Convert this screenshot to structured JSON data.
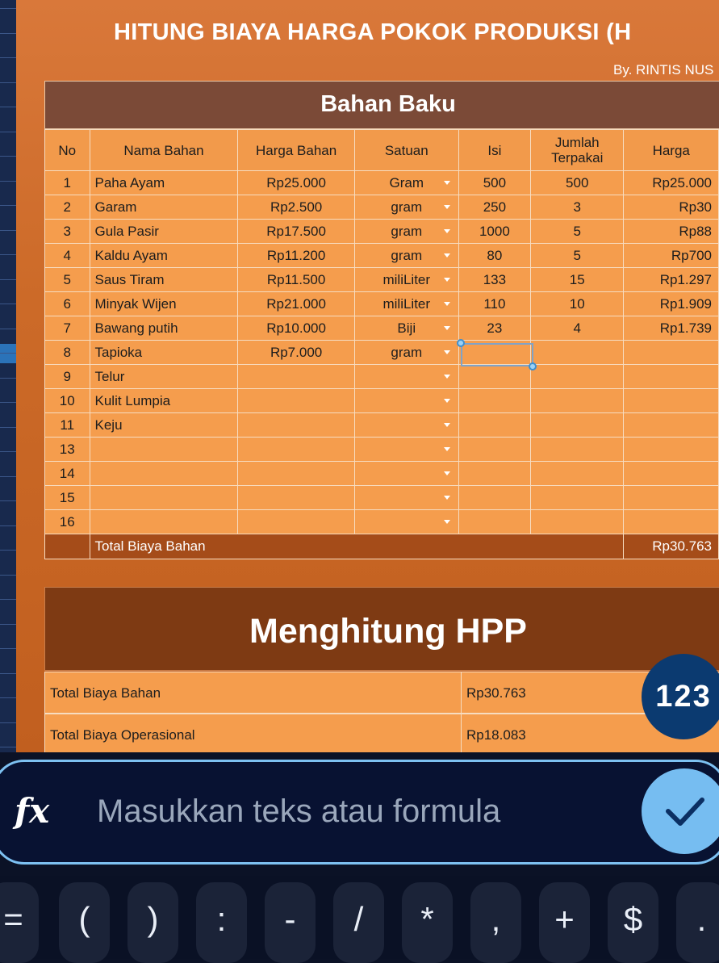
{
  "sheet": {
    "title": "HITUNG BIAYA HARGA POKOK PRODUKSI (H",
    "byline": "By. RINTIS NUS"
  },
  "bahan_baku": {
    "title": "Bahan Baku",
    "headers": [
      "No",
      "Nama Bahan",
      "Harga Bahan",
      "Satuan",
      "Isi",
      "Jumlah Terpakai",
      "Harga"
    ],
    "rows": [
      {
        "no": "1",
        "nama": "Paha Ayam",
        "harga_bahan": "Rp25.000",
        "satuan": "Gram",
        "isi": "500",
        "terpakai": "500",
        "harga": "Rp25.000"
      },
      {
        "no": "2",
        "nama": "Garam",
        "harga_bahan": "Rp2.500",
        "satuan": "gram",
        "isi": "250",
        "terpakai": "3",
        "harga": "Rp30"
      },
      {
        "no": "3",
        "nama": "Gula Pasir",
        "harga_bahan": "Rp17.500",
        "satuan": "gram",
        "isi": "1000",
        "terpakai": "5",
        "harga": "Rp88"
      },
      {
        "no": "4",
        "nama": "Kaldu Ayam",
        "harga_bahan": "Rp11.200",
        "satuan": "gram",
        "isi": "80",
        "terpakai": "5",
        "harga": "Rp700"
      },
      {
        "no": "5",
        "nama": "Saus Tiram",
        "harga_bahan": "Rp11.500",
        "satuan": "miliLiter",
        "isi": "133",
        "terpakai": "15",
        "harga": "Rp1.297"
      },
      {
        "no": "6",
        "nama": "Minyak Wijen",
        "harga_bahan": "Rp21.000",
        "satuan": "miliLiter",
        "isi": "110",
        "terpakai": "10",
        "harga": "Rp1.909"
      },
      {
        "no": "7",
        "nama": "Bawang putih",
        "harga_bahan": "Rp10.000",
        "satuan": "Biji",
        "isi": "23",
        "terpakai": "4",
        "harga": "Rp1.739"
      },
      {
        "no": "8",
        "nama": "Tapioka",
        "harga_bahan": "Rp7.000",
        "satuan": "gram",
        "isi": "",
        "terpakai": "",
        "harga": ""
      },
      {
        "no": "9",
        "nama": "Telur",
        "harga_bahan": "",
        "satuan": "",
        "isi": "",
        "terpakai": "",
        "harga": ""
      },
      {
        "no": "10",
        "nama": "Kulit Lumpia",
        "harga_bahan": "",
        "satuan": "",
        "isi": "",
        "terpakai": "",
        "harga": ""
      },
      {
        "no": "11",
        "nama": "Keju",
        "harga_bahan": "",
        "satuan": "",
        "isi": "",
        "terpakai": "",
        "harga": ""
      },
      {
        "no": "13",
        "nama": "",
        "harga_bahan": "",
        "satuan": "",
        "isi": "",
        "terpakai": "",
        "harga": ""
      },
      {
        "no": "14",
        "nama": "",
        "harga_bahan": "",
        "satuan": "",
        "isi": "",
        "terpakai": "",
        "harga": ""
      },
      {
        "no": "15",
        "nama": "",
        "harga_bahan": "",
        "satuan": "",
        "isi": "",
        "terpakai": "",
        "harga": ""
      },
      {
        "no": "16",
        "nama": "",
        "harga_bahan": "",
        "satuan": "",
        "isi": "",
        "terpakai": "",
        "harga": ""
      }
    ],
    "total_label": "Total Biaya Bahan",
    "total_value": "Rp30.763"
  },
  "hpp": {
    "title": "Menghitung HPP",
    "rows": [
      {
        "label": "Total Biaya Bahan",
        "value": "Rp30.763"
      },
      {
        "label": "Total Biaya Operasional",
        "value": "Rp18.083"
      }
    ]
  },
  "fab_label": "123",
  "formula_bar": {
    "fx_label": "fx",
    "placeholder": "Masukkan teks atau formula"
  },
  "keys": [
    "=",
    "(",
    ")",
    ":",
    "-",
    "/",
    "*",
    ",",
    "+",
    "$",
    "."
  ],
  "colors": {
    "accent": "#76bdf1",
    "header_brown": "#7b4a37",
    "cell_orange": "#f59d4d",
    "total_brown": "#a54c19"
  }
}
